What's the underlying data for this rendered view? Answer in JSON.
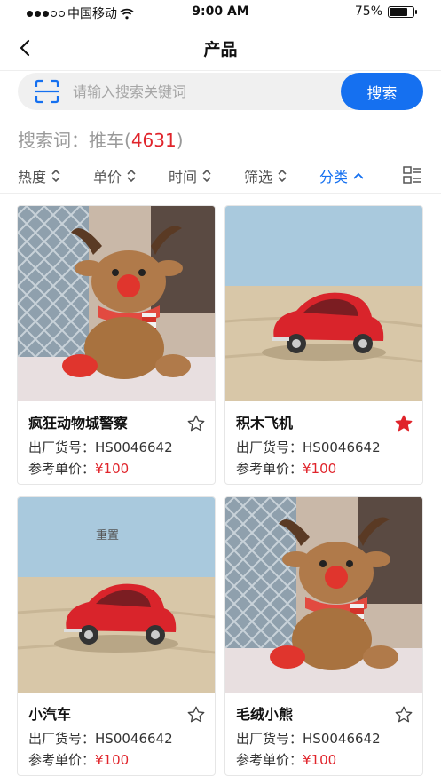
{
  "status_bar": {
    "carrier": "中国移动",
    "time": "9:00 AM",
    "battery": "75%",
    "battery_level": 0.75
  },
  "nav": {
    "title": "产品"
  },
  "search": {
    "placeholder": "请输入搜索关键词",
    "button_label": "搜索"
  },
  "keyword": {
    "label": "搜索词：",
    "term": "推车",
    "count": "4631"
  },
  "sort_bar": {
    "items": [
      {
        "label": "热度",
        "icon": "sort-updown-icon"
      },
      {
        "label": "单价",
        "icon": "sort-updown-icon"
      },
      {
        "label": "时间",
        "icon": "sort-updown-icon"
      },
      {
        "label": "筛选",
        "icon": "sort-updown-icon"
      },
      {
        "label": "分类",
        "icon": "chevron-up-icon",
        "active": true
      }
    ]
  },
  "accent_color": "#1570f0",
  "price_color": "#e0242b",
  "products": [
    {
      "name": "疯狂动物城警察",
      "code_label": "出厂货号：",
      "code": "HS0046642",
      "price_label": "参考单价：",
      "price": "¥100",
      "favorited": false,
      "image": "reindeer-plush"
    },
    {
      "name": "积木飞机",
      "code_label": "出厂货号：",
      "code": "HS0046642",
      "price_label": "参考单价：",
      "price": "¥100",
      "favorited": true,
      "image": "red-toy-car"
    },
    {
      "name": "小汽车",
      "code_label": "出厂货号：",
      "code": "HS0046642",
      "price_label": "参考单价：",
      "price": "¥100",
      "favorited": false,
      "image": "red-toy-car",
      "overlay_text": "重置"
    },
    {
      "name": "毛绒小熊",
      "code_label": "出厂货号：",
      "code": "HS0046642",
      "price_label": "参考单价：",
      "price": "¥100",
      "favorited": false,
      "image": "reindeer-plush"
    }
  ]
}
